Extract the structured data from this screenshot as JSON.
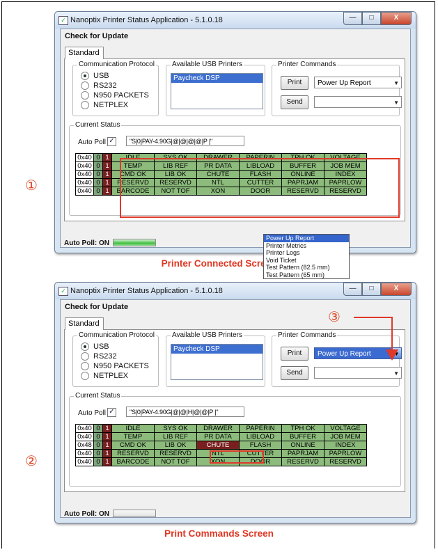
{
  "window": {
    "title": "Nanoptix Printer Status Application - 5.1.0.18",
    "min_label": "—",
    "max_label": "□",
    "close_label": "X",
    "menu_check_update": "Check for Update",
    "tab_standard": "Standard"
  },
  "protocol": {
    "label": "Communication Protocol",
    "options": [
      "USB",
      "RS232",
      "N950 PACKETS",
      "NETPLEX"
    ],
    "selected": "USB"
  },
  "usb": {
    "label": "Available USB Printers",
    "items": [
      "Paycheck DSP"
    ]
  },
  "commands": {
    "label": "Printer Commands",
    "print_label": "Print",
    "send_label": "Send",
    "print_value": "Power Up Report",
    "send_value": "",
    "dropdown_options": [
      "Power Up Report",
      "Printer Metrics",
      "Printer Logs",
      "Void Ticket",
      "Test Pattern (82.5 mm)",
      "Test Pattern (65 mm)"
    ],
    "dropdown_selected": "Power Up Report"
  },
  "status": {
    "label": "Current Status",
    "auto_poll_label": "Auto Poll",
    "auto_poll_checked": "✓",
    "field_value_1": "\"S|0|PAY-4.90G|@|@|@|@|P |\"",
    "field_value_2": "\"S|0|PAY-4.90G|@|@|H|@|@|P |\"",
    "rows_1": [
      {
        "hex": "0x40",
        "zero": "0",
        "one": "1",
        "cells": [
          "IDLE",
          "SYS OK",
          "DRAWER",
          "PAPERIN",
          "TPH OK",
          "VOLTAGE"
        ]
      },
      {
        "hex": "0x40",
        "zero": "0",
        "one": "1",
        "cells": [
          "TEMP",
          "LIB REF",
          "PR DATA",
          "LIBLOAD",
          "BUFFER",
          "JOB MEM"
        ]
      },
      {
        "hex": "0x40",
        "zero": "0",
        "one": "1",
        "cells": [
          "CMD OK",
          "LIB OK",
          "CHUTE",
          "FLASH",
          "ONLINE",
          "INDEX"
        ]
      },
      {
        "hex": "0x40",
        "zero": "0",
        "one": "1",
        "cells": [
          "RESERVD",
          "RESERVD",
          "NTL",
          "CUTTER",
          "PAPRJAM",
          "PAPRLOW"
        ]
      },
      {
        "hex": "0x40",
        "zero": "0",
        "one": "1",
        "cells": [
          "BARCODE",
          "NOT TOF",
          "XON",
          "DOOR",
          "RESERVD",
          "RESERVD"
        ]
      }
    ],
    "rows_2": [
      {
        "hex": "0x40",
        "zero": "0",
        "one": "1",
        "cells": [
          "IDLE",
          "SYS OK",
          "DRAWER",
          "PAPERIN",
          "TPH OK",
          "VOLTAGE"
        ]
      },
      {
        "hex": "0x40",
        "zero": "0",
        "one": "1",
        "cells": [
          "TEMP",
          "LIB REF",
          "PR DATA",
          "LIBLOAD",
          "BUFFER",
          "JOB MEM"
        ]
      },
      {
        "hex": "0x48",
        "zero": "0",
        "one": "1",
        "cells": [
          "CMD OK",
          "LIB OK",
          "CHUTE",
          "FLASH",
          "ONLINE",
          "INDEX"
        ]
      },
      {
        "hex": "0x40",
        "zero": "0",
        "one": "1",
        "cells": [
          "RESERVD",
          "RESERVD",
          "NTL",
          "CUTTER",
          "PAPRJAM",
          "PAPRLOW"
        ]
      },
      {
        "hex": "0x40",
        "zero": "0",
        "one": "1",
        "cells": [
          "BARCODE",
          "NOT TOF",
          "XON",
          "DOOR",
          "RESERVD",
          "RESERVD"
        ]
      }
    ],
    "alert_cell_2": "CHUTE",
    "colors": {
      "ok": "#8cbb7c",
      "alert": "#7a1f1f"
    }
  },
  "statusbar": {
    "label": "Auto Poll: ON"
  },
  "captions": {
    "screen1": "Printer Connected Screen",
    "screen2": "Print Commands Screen"
  },
  "callouts": [
    "①",
    "②",
    "③"
  ]
}
